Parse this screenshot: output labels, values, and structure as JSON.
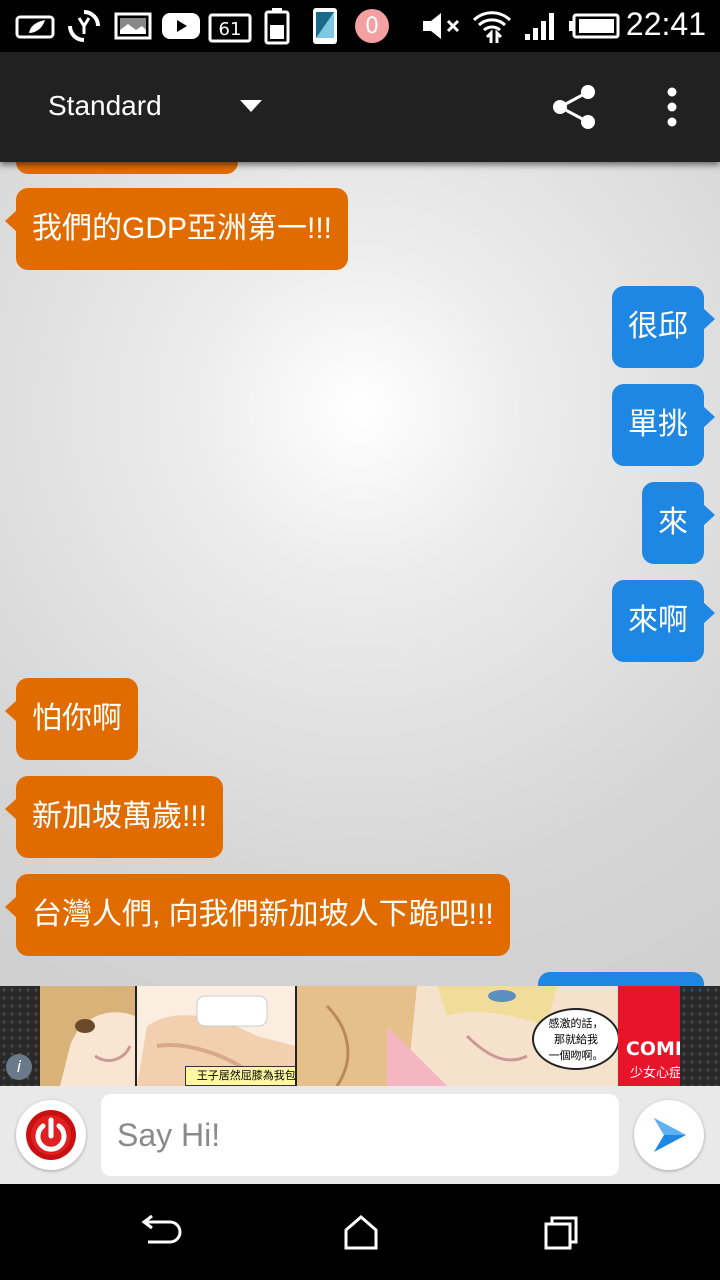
{
  "status_bar": {
    "time": "22:41",
    "notification_count": "61",
    "badge_text": "0",
    "icons": [
      "leaf-icon",
      "sync-icon",
      "image-icon",
      "youtube-icon",
      "notification-count-icon",
      "battery-small-icon",
      "phone-icon",
      "badge-icon",
      "mute-icon",
      "wifi-icon",
      "signal-icon",
      "battery-icon"
    ]
  },
  "toolbar": {
    "mode_label": "Standard",
    "icons": [
      "dropdown-caret-icon",
      "share-icon",
      "more-vert-icon"
    ]
  },
  "messages": [
    {
      "side": "left",
      "text": "我們的GDP亞洲第一!!!"
    },
    {
      "side": "right",
      "text": "很邱"
    },
    {
      "side": "right",
      "text": "單挑"
    },
    {
      "side": "right",
      "text": "來"
    },
    {
      "side": "right",
      "text": "來啊"
    },
    {
      "side": "left",
      "text": "怕你啊"
    },
    {
      "side": "left",
      "text": "新加坡萬歲!!!"
    },
    {
      "side": "left",
      "text": "台灣人們, 向我們新加坡人下跪吧!!!"
    }
  ],
  "ad": {
    "caption": "王子居然屈膝為我包紮!",
    "speech_line1": "感激的話，",
    "speech_line2": "那就給我",
    "speech_line3": "一個吻啊。",
    "brand": "COMICO",
    "brand_tagline": "少女心症候群",
    "info_label": "i"
  },
  "input_bar": {
    "placeholder": "Say Hi!",
    "icons": [
      "power-icon",
      "send-arrow-icon"
    ]
  },
  "nav_bar": {
    "icons": [
      "back-icon",
      "home-icon",
      "recents-icon"
    ]
  },
  "colors": {
    "left_bubble": "#e06c00",
    "right_bubble": "#1e87e3",
    "toolbar": "#212121",
    "ad_brand": "#e8142a"
  }
}
